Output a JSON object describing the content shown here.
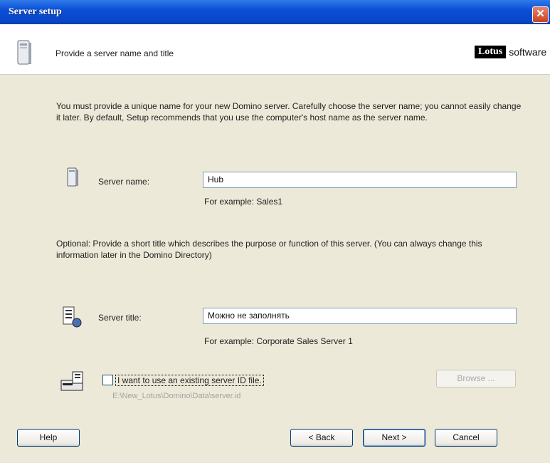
{
  "window": {
    "title": "Server setup"
  },
  "header": {
    "text": "Provide a server name and title",
    "logo_brand": "Lotus",
    "logo_suffix": "software"
  },
  "intro": "You must provide a unique name for your new Domino server. Carefully choose the server name; you cannot easily change it later. By default, Setup recommends that you use the computer's host name as the server name.",
  "server_name": {
    "label": "Server name:",
    "value": "Hub",
    "hint": "For example: Sales1"
  },
  "optional": "Optional: Provide a short title which describes the purpose or function of this server. (You can always change this information later in the Domino Directory)",
  "server_title": {
    "label": "Server title:",
    "value": "Можно не заполнять",
    "hint": "For example: Corporate Sales Server 1"
  },
  "existing_id": {
    "label": "I want to use an existing server ID file.",
    "checked": false,
    "path": "E:\\New_Lotus\\Domino\\Data\\server.id",
    "browse": "Browse ..."
  },
  "buttons": {
    "help": "Help",
    "back": "< Back",
    "next": "Next >",
    "cancel": "Cancel"
  },
  "colors": {
    "titlebar": "#0b4fd6",
    "dialog_bg": "#ece9d8"
  }
}
